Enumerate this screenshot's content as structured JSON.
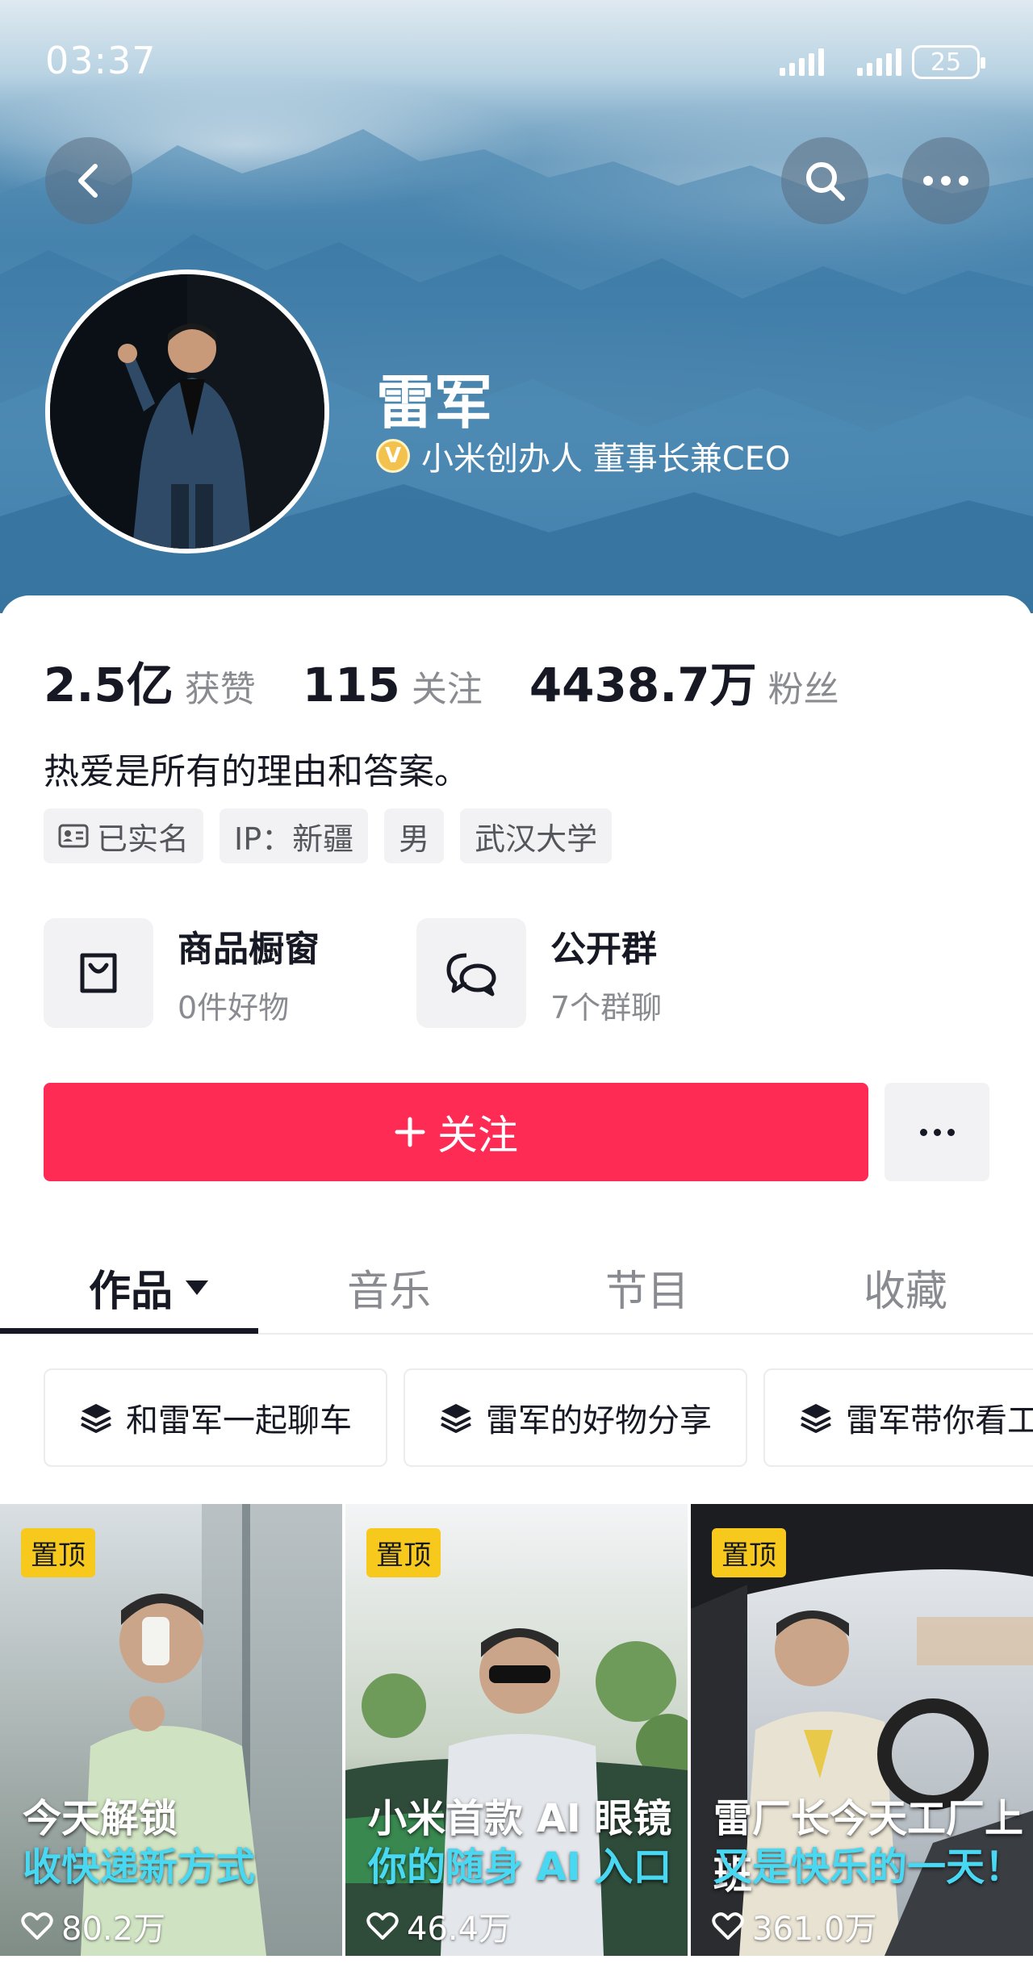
{
  "status": {
    "time": "03:37",
    "battery": "25"
  },
  "profile": {
    "name": "雷军",
    "verification": "小米创办人 董事长兼CEO",
    "stats": [
      {
        "value": "2.5亿",
        "label": "获赞"
      },
      {
        "value": "115",
        "label": "关注"
      },
      {
        "value": "4438.7万",
        "label": "粉丝"
      }
    ],
    "bio": "热爱是所有的理由和答案。",
    "tags": [
      "已实名",
      "IP：新疆",
      "男",
      "武汉大学"
    ]
  },
  "features": [
    {
      "title": "商品橱窗",
      "sub": "0件好物",
      "icon": "shopping-bag-icon"
    },
    {
      "title": "公开群",
      "sub": "7个群聊",
      "icon": "chat-bubbles-icon"
    }
  ],
  "actions": {
    "follow_label": "关注"
  },
  "tabs": [
    "作品",
    "音乐",
    "节目",
    "收藏"
  ],
  "collections": [
    "和雷军一起聊车",
    "雷军的好物分享",
    "雷军带你看工厂"
  ],
  "videos": [
    {
      "pin": "置顶",
      "line1": "今天解锁",
      "line2": "收快递新方式",
      "likes": "80.2万"
    },
    {
      "pin": "置顶",
      "line1": "小米首款 AI 眼镜",
      "line2": "你的随身 AI 入口",
      "likes": "46.4万"
    },
    {
      "pin": "置顶",
      "line1": "雷厂长今天工厂上班",
      "line2": "又是快乐的一天！",
      "likes": "361.0万"
    }
  ],
  "colors": {
    "accent": "#fe2c55",
    "pin": "#f8c91d",
    "caption_highlight": "#49d8f2"
  }
}
